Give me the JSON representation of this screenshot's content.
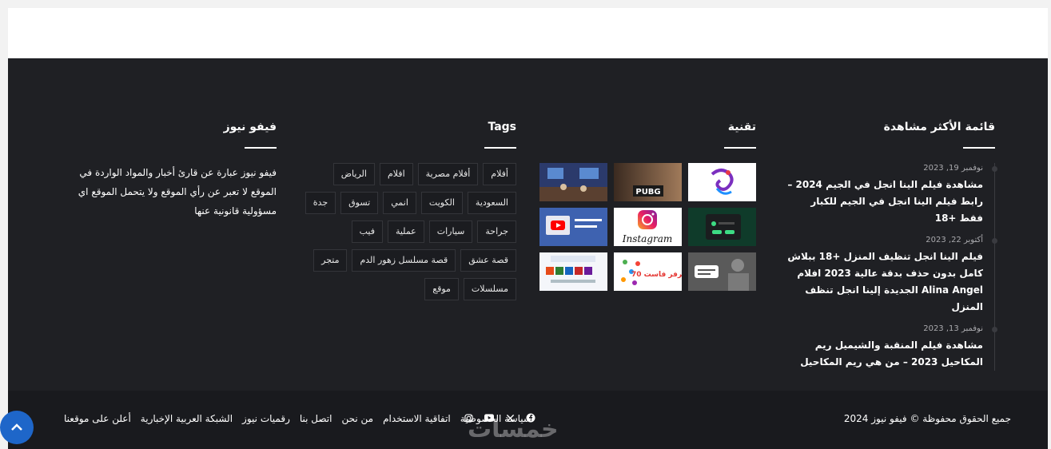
{
  "most_viewed": {
    "title": "قائمة الأكثر مشاهدة",
    "items": [
      {
        "date": "نوفمبر 19, 2023",
        "title": "مشاهدة فيلم الينا انجل في الجيم 2024 – رابط فيلم الينا انجل في الجيم للكبار فقط +18"
      },
      {
        "date": "أكتوبر 22, 2023",
        "title": "فيلم الينا انجل تنظيف المنزل +18 ببلاش كامل بدون حذف بدقة عالية 2023 افلام Alina Angel الجديدة إلينا انجل تنظف المنزل"
      },
      {
        "date": "نوفمبر 13, 2023",
        "title": "مشاهدة فيلم المنقبة والشيميل ريم المكاحيل 2023 – من هي ريم المكاحيل"
      }
    ]
  },
  "tech": {
    "title": "تقنية",
    "thumbs": [
      {
        "label": "",
        "icon": "logo-bird-thumb"
      },
      {
        "label": "PUBG",
        "icon": "pubg-thumb"
      },
      {
        "label": "",
        "icon": "classroom-thumb"
      },
      {
        "label": "",
        "icon": "app-screen-thumb"
      },
      {
        "label": "Instagram",
        "icon": "instagram-thumb"
      },
      {
        "label": "",
        "icon": "youtube-thumb"
      },
      {
        "label": "",
        "icon": "people-thumb"
      },
      {
        "label": "سيرفر فاست 70",
        "icon": "server-thumb"
      },
      {
        "label": "",
        "icon": "office-thumb"
      }
    ]
  },
  "tags": {
    "title": "Tags",
    "items": [
      "أفلام",
      "أفلام مصرية",
      "افلام",
      "الرياض",
      "السعودية",
      "الكويت",
      "انمي",
      "تسوق",
      "جدة",
      "جراحة",
      "سيارات",
      "عملية",
      "فيب",
      "قصة عشق",
      "قصة مسلسل زهور الدم",
      "متجر",
      "مسلسلات",
      "موقع"
    ]
  },
  "about": {
    "title": "فيفو نيوز",
    "text": "فيفو نيوز عبارة عن قارئ أخبار والمواد الواردة في الموقع لا تعبر عن رأي الموقع ولا يتحمل الموقع اي مسؤولية قانونية عنها"
  },
  "bottom": {
    "copyright": "جميع الحقوق محفوظة © فيفو نيوز 2024",
    "links": [
      "سياسة الخصوصية",
      "اتفاقية الاستخدام",
      "من نحن",
      "اتصل بنا",
      "رقميات نيوز",
      "الشبكة العربية الإخبارية",
      "أعلن على موقعنا"
    ],
    "socials": [
      "facebook-icon",
      "x-icon",
      "youtube-icon",
      "instagram-icon"
    ],
    "watermark": "خمسات"
  },
  "colors": {
    "footer_bg": "#1f2024",
    "bottom_bg": "#191a1e",
    "accent": "#1e66c9"
  }
}
